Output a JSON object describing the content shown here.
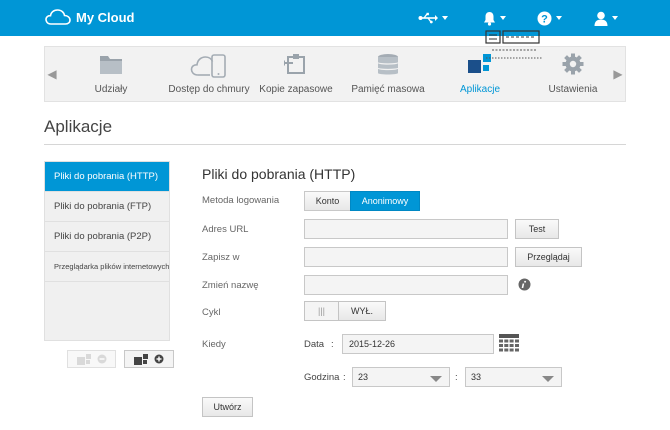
{
  "header": {
    "app_title": "My Cloud",
    "icons": [
      "cloud-logo-icon",
      "usb-icon",
      "bell-icon",
      "help-icon",
      "user-icon"
    ]
  },
  "nav": {
    "items": [
      {
        "label": "Udziały",
        "icon": "folder-icon"
      },
      {
        "label": "Dostęp do chmury",
        "icon": "cloud-device-icon"
      },
      {
        "label": "Kopie zapasowe",
        "icon": "backup-icon"
      },
      {
        "label": "Pamięć masowa",
        "icon": "storage-icon"
      },
      {
        "label": "Aplikacje",
        "icon": "apps-icon"
      },
      {
        "label": "Ustawienia",
        "icon": "gear-icon"
      }
    ],
    "active": "Aplikacje"
  },
  "page_title": "Aplikacje",
  "sidebar": {
    "items": [
      {
        "label": "Pliki do pobrania (HTTP)"
      },
      {
        "label": "Pliki do pobrania (FTP)"
      },
      {
        "label": "Pliki do pobrania (P2P)"
      },
      {
        "label": "Przeglądarka plików internetowych"
      }
    ]
  },
  "form": {
    "title": "Pliki do pobrania (HTTP)",
    "login_method_label": "Metoda logowania",
    "login_options": [
      "Konto",
      "Anonimowy"
    ],
    "login_selected": "Anonimowy",
    "url_label": "Adres URL",
    "url_value": "",
    "test_button": "Test",
    "save_to_label": "Zapisz w",
    "save_to_value": "",
    "browse_button": "Przeglądaj",
    "rename_label": "Zmień nazwę",
    "rename_value": "",
    "cycle_label": "Cykl",
    "cycle_toggle_on": "|||",
    "cycle_toggle_off": "WYŁ.",
    "when_label": "Kiedy",
    "date_label": "Data",
    "date_sep": ":",
    "date_value": "2015-12-26",
    "time_label": "Godzina",
    "time_sep1": ":",
    "hour_value": "23",
    "time_sep2": ":",
    "minute_value": "33",
    "create_button": "Utwórz"
  },
  "colors": {
    "accent": "#0096d6",
    "nav_bg": "#f2f2f2",
    "sidebar_bg": "#f0f0f0"
  }
}
